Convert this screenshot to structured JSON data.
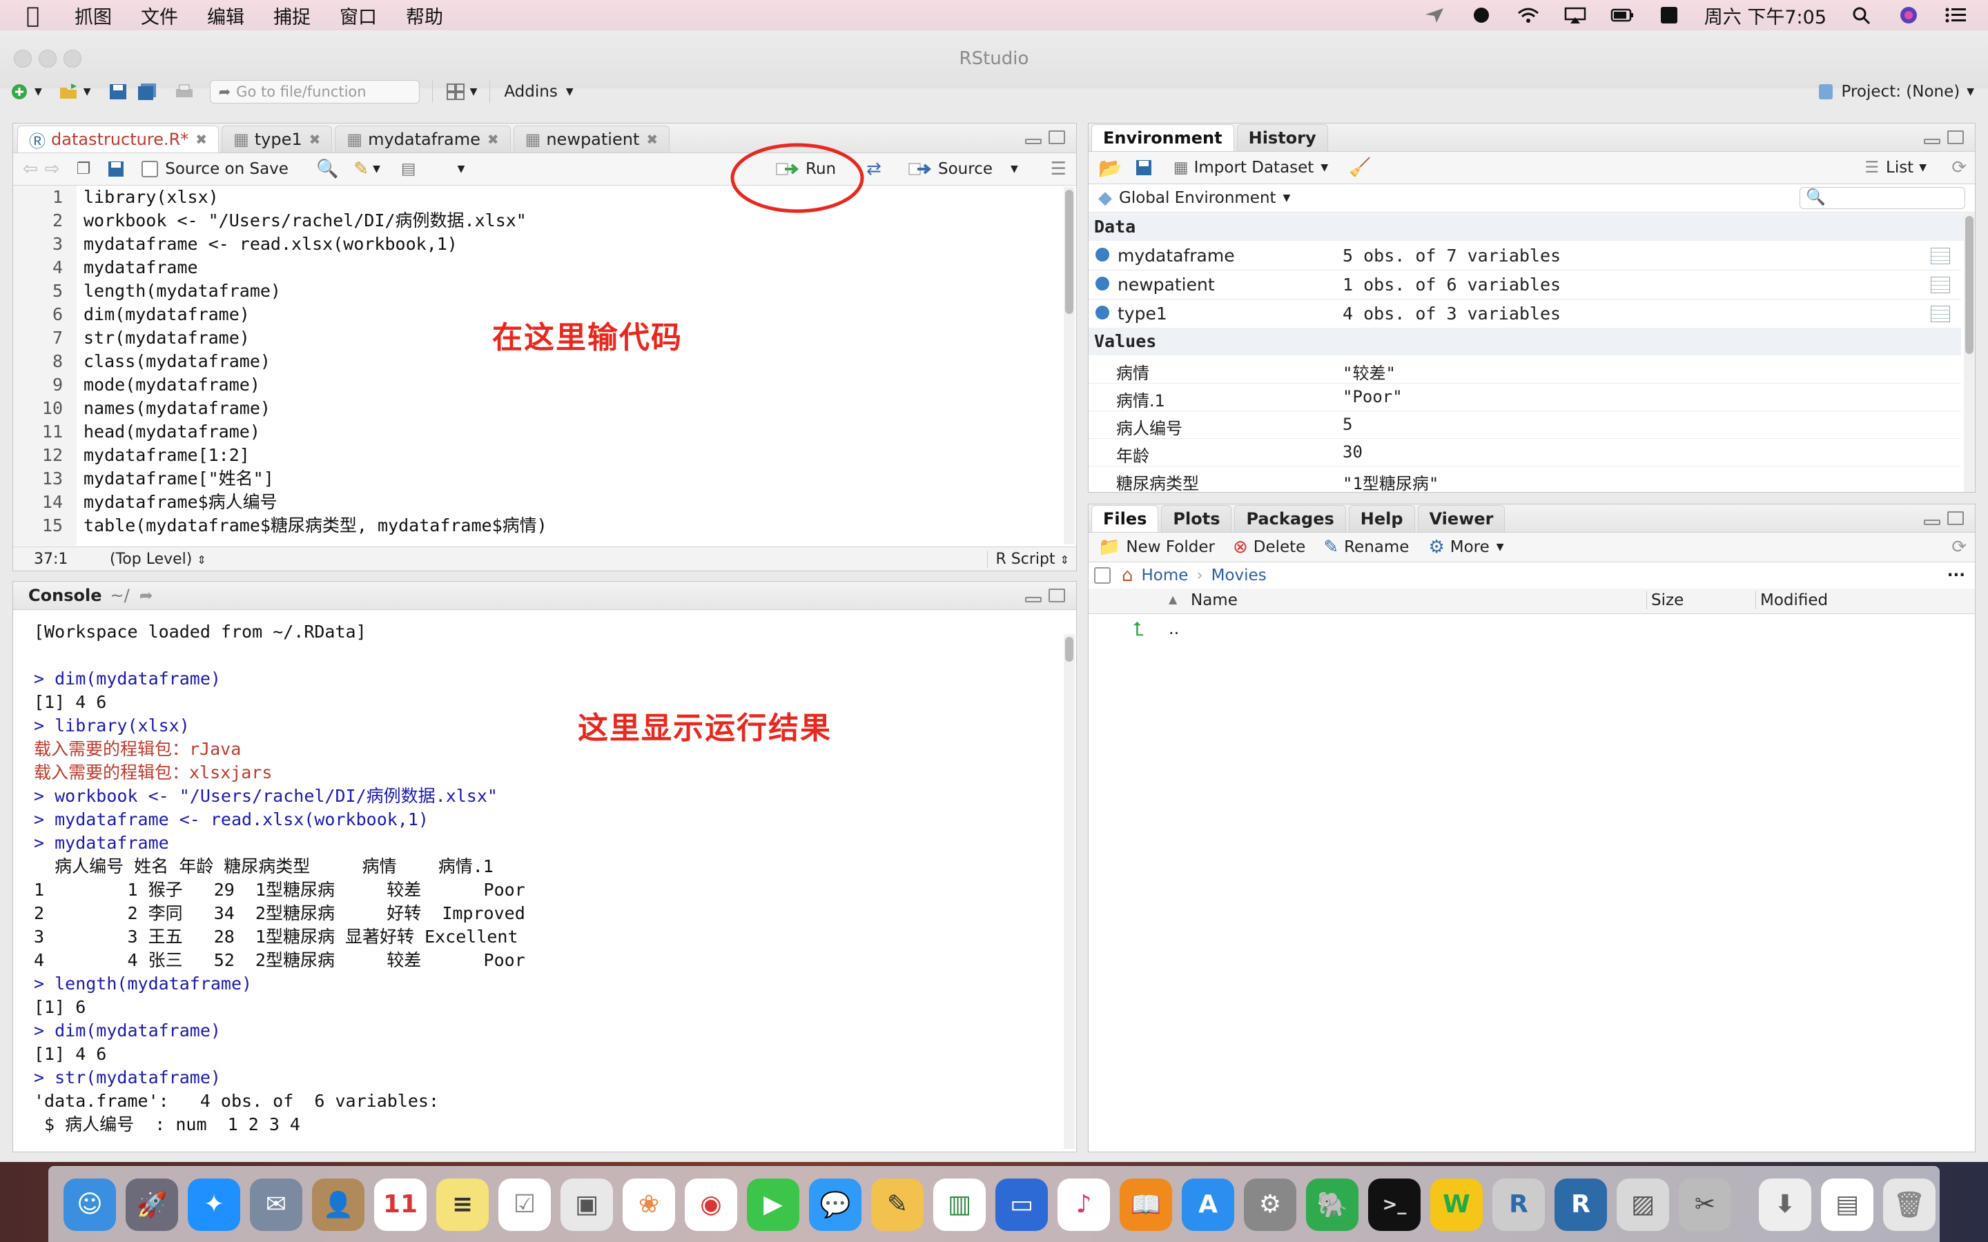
{
  "menubar": {
    "items": [
      "抓图",
      "文件",
      "编辑",
      "捕捉",
      "窗口",
      "帮助"
    ],
    "clock": "周六 下午7:05"
  },
  "window": {
    "title": "RStudio",
    "goto_placeholder": "Go to file/function",
    "addins_label": "Addins",
    "project_label": "Project: (None)"
  },
  "editor": {
    "tabs": [
      {
        "label": "datastructure.R*",
        "active": true
      },
      {
        "label": "type1",
        "active": false
      },
      {
        "label": "mydataframe",
        "active": false
      },
      {
        "label": "newpatient",
        "active": false
      }
    ],
    "source_on_save": "Source on Save",
    "run_label": "Run",
    "source_label": "Source",
    "lines": [
      {
        "n": "1",
        "code": "library(xlsx)"
      },
      {
        "n": "2",
        "code": "workbook <- \"/Users/rachel/DI/病例数据.xlsx\""
      },
      {
        "n": "3",
        "code": "mydataframe <- read.xlsx(workbook,1)"
      },
      {
        "n": "4",
        "code": "mydataframe"
      },
      {
        "n": "5",
        "code": "length(mydataframe)"
      },
      {
        "n": "6",
        "code": "dim(mydataframe)"
      },
      {
        "n": "7",
        "code": "str(mydataframe)"
      },
      {
        "n": "8",
        "code": "class(mydataframe)"
      },
      {
        "n": "9",
        "code": "mode(mydataframe)"
      },
      {
        "n": "10",
        "code": "names(mydataframe)"
      },
      {
        "n": "11",
        "code": "head(mydataframe)"
      },
      {
        "n": "12",
        "code": "mydataframe[1:2]"
      },
      {
        "n": "13",
        "code": "mydataframe[\"姓名\"]"
      },
      {
        "n": "14",
        "code": "mydataframe$病人编号"
      },
      {
        "n": "15",
        "code": "table(mydataframe$糖尿病类型, mydataframe$病情)"
      }
    ],
    "cursor_pos": "37:1",
    "scope": "(Top Level)",
    "filetype": "R Script",
    "annotation": "在这里输代码"
  },
  "console": {
    "title": "Console",
    "path": "~/",
    "annotation": "这里显示运行结果",
    "lines": [
      {
        "t": "out",
        "text": "[Workspace loaded from ~/.RData]"
      },
      {
        "t": "out",
        "text": ""
      },
      {
        "t": "cmd",
        "text": "> dim(mydataframe)"
      },
      {
        "t": "out",
        "text": "[1] 4 6"
      },
      {
        "t": "cmd",
        "text": "> library(xlsx)"
      },
      {
        "t": "msg",
        "text": "载入需要的程辑包：rJava"
      },
      {
        "t": "msg",
        "text": "载入需要的程辑包：xlsxjars"
      },
      {
        "t": "cmd",
        "text": "> workbook <- \"/Users/rachel/DI/病例数据.xlsx\""
      },
      {
        "t": "cmd",
        "text": "> mydataframe <- read.xlsx(workbook,1)"
      },
      {
        "t": "cmd",
        "text": "> mydataframe"
      },
      {
        "t": "out",
        "text": "  病人编号 姓名 年龄 糖尿病类型     病情    病情.1"
      },
      {
        "t": "out",
        "text": "1        1 猴子   29  1型糖尿病     较差      Poor"
      },
      {
        "t": "out",
        "text": "2        2 李同   34  2型糖尿病     好转  Improved"
      },
      {
        "t": "out",
        "text": "3        3 王五   28  1型糖尿病 显著好转 Excellent"
      },
      {
        "t": "out",
        "text": "4        4 张三   52  2型糖尿病     较差      Poor"
      },
      {
        "t": "cmd",
        "text": "> length(mydataframe)"
      },
      {
        "t": "out",
        "text": "[1] 6"
      },
      {
        "t": "cmd",
        "text": "> dim(mydataframe)"
      },
      {
        "t": "out",
        "text": "[1] 4 6"
      },
      {
        "t": "cmd",
        "text": "> str(mydataframe)"
      },
      {
        "t": "out",
        "text": "'data.frame':   4 obs. of  6 variables:"
      },
      {
        "t": "out",
        "text": " $ 病人编号  : num  1 2 3 4"
      }
    ]
  },
  "environment": {
    "tabs": [
      "Environment",
      "History"
    ],
    "import_label": "Import Dataset",
    "list_label": "List",
    "scope_label": "Global Environment",
    "data_header": "Data",
    "values_header": "Values",
    "data": [
      {
        "name": "mydataframe",
        "value": "5 obs. of 7 variables"
      },
      {
        "name": "newpatient",
        "value": "1 obs. of 6 variables"
      },
      {
        "name": "type1",
        "value": "4 obs. of 3 variables"
      }
    ],
    "values": [
      {
        "name": "病情",
        "value": "\"较差\""
      },
      {
        "name": "病情.1",
        "value": "\"Poor\""
      },
      {
        "name": "病人编号",
        "value": "5"
      },
      {
        "name": "年龄",
        "value": "30"
      },
      {
        "name": "糖尿病类型",
        "value": "\"1型糖尿病\""
      }
    ]
  },
  "files": {
    "tabs": [
      "Files",
      "Plots",
      "Packages",
      "Help",
      "Viewer"
    ],
    "new_folder": "New Folder",
    "delete": "Delete",
    "rename": "Rename",
    "more": "More",
    "breadcrumb": [
      "Home",
      "Movies"
    ],
    "columns": [
      "Name",
      "Size",
      "Modified"
    ],
    "rows": [
      ".."
    ]
  },
  "colors": {
    "accent_red": "#e8281f",
    "tab_active_text": "#c0392b"
  }
}
